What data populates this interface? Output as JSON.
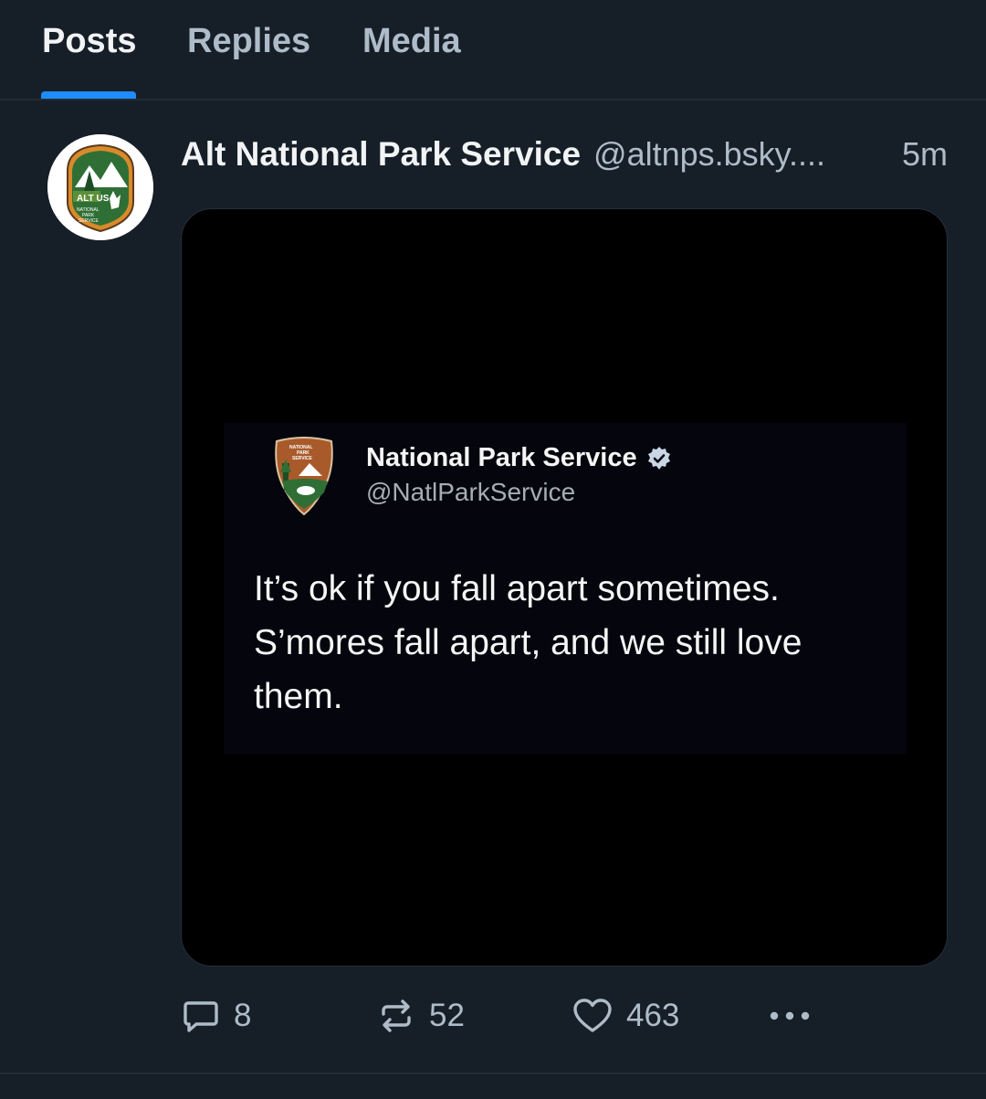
{
  "tabs": [
    {
      "label": "Posts",
      "active": true
    },
    {
      "label": "Replies",
      "active": false
    },
    {
      "label": "Media",
      "active": false
    }
  ],
  "post": {
    "author": {
      "display_name": "Alt National Park Service",
      "handle": "@altnps.bsky....",
      "avatar_logo_text": "ALT US NATIONAL PARK SERVICE"
    },
    "timestamp": "5m",
    "embedded_image": {
      "quoted_post": {
        "display_name": "National Park Service",
        "verified": true,
        "handle": "@NatlParkService",
        "logo_text": "NATIONAL PARK SERVICE",
        "text": "It’s ok if you fall apart sometimes. S’mores fall apart, and we still love them."
      }
    },
    "actions": {
      "reply_count": "8",
      "repost_count": "52",
      "like_count": "463"
    }
  },
  "colors": {
    "background": "#161e27",
    "accent": "#208bfe",
    "text_primary": "#f1f3f5",
    "text_secondary": "#aebbc9"
  },
  "icons": {
    "reply": "speech-bubble-icon",
    "repost": "repost-arrows-icon",
    "like": "heart-icon",
    "more": "ellipsis-icon",
    "verified": "verified-badge-icon"
  }
}
